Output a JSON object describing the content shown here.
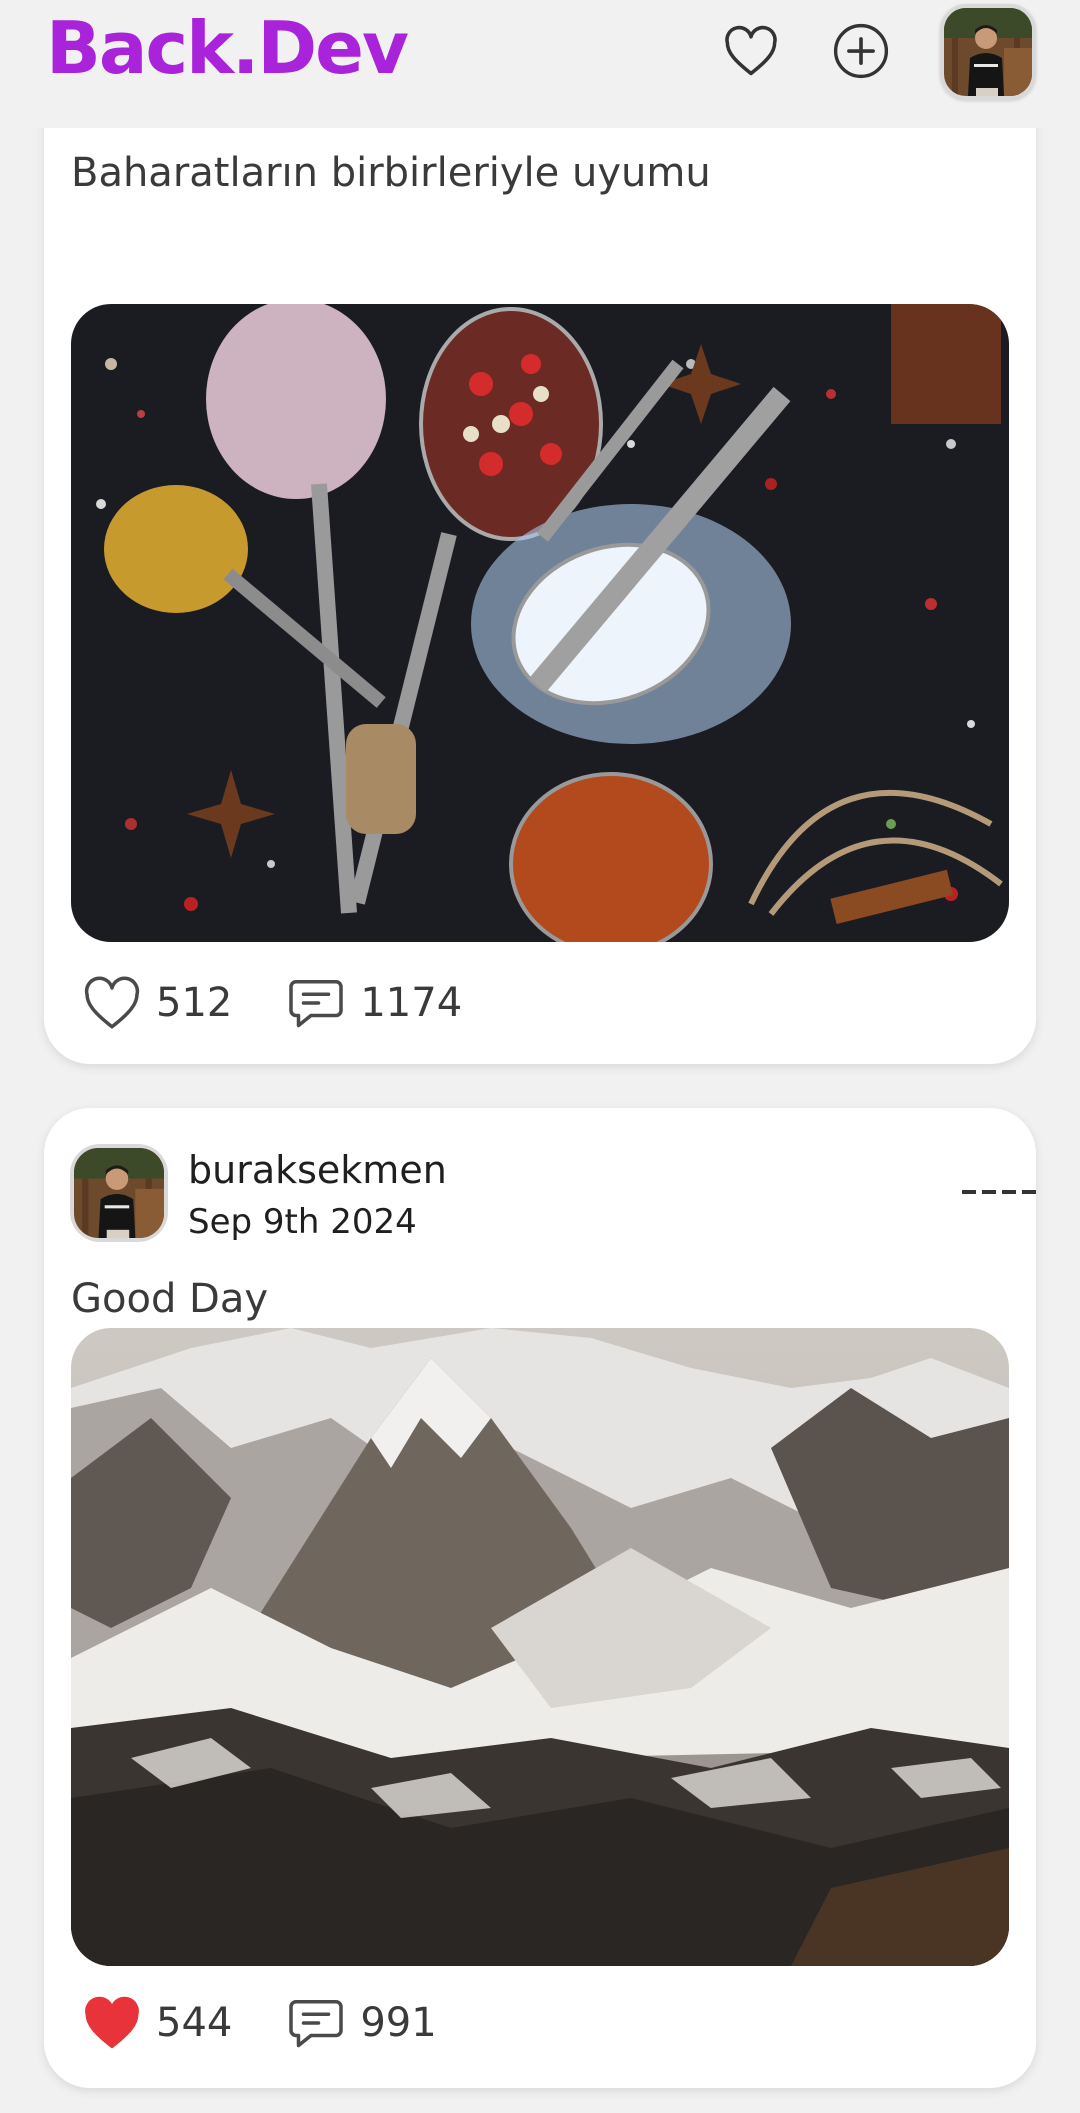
{
  "app": {
    "title": "Back.Dev"
  },
  "colors": {
    "brand": "#a823d9",
    "liked": "#e8333a",
    "icon": "#4a4a4a"
  },
  "header": {
    "icons": [
      "heart-icon",
      "plus-circle-icon",
      "avatar"
    ]
  },
  "posts": [
    {
      "caption": "Baharatların birbirleriyle uyumu",
      "likes": "512",
      "comments": "1174",
      "liked": false
    },
    {
      "author": "buraksekmen",
      "date": "Sep 9th 2024",
      "caption": "Good Day",
      "likes": "544",
      "comments": "991",
      "liked": true
    }
  ]
}
